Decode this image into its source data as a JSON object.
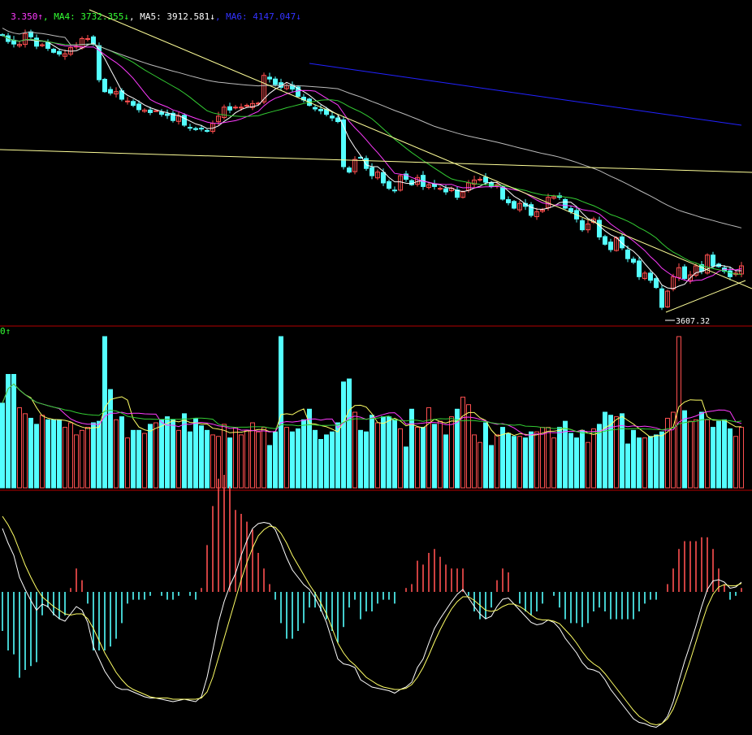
{
  "header": {
    "items": [
      {
        "text": "3.350↑",
        "color": "#ff3bff"
      },
      {
        "text": ", MA4: 3732.355↓",
        "color": "#33ff33"
      },
      {
        "text": ", MA5: 3912.581↓",
        "color": "#ffffff"
      },
      {
        "text": ", MA6: 4147.047↓",
        "color": "#3333ff"
      }
    ]
  },
  "volume_header": {
    "text": "0↑",
    "color": "#33ff33"
  },
  "colors": {
    "up": "#ff5050",
    "down": "#54ffff",
    "ma_white": "#ffffff",
    "ma_yellow": "#ffff66",
    "ma_magenta": "#ff3bff",
    "ma_green": "#33cc33",
    "ma_grey": "#bbbbbb",
    "ma_blue": "#2222ff",
    "panel_border": "#b40000",
    "trend_line": "#ffff99"
  },
  "chart_data": [
    {
      "type": "candlestick",
      "title": "",
      "price_range": [
        3570,
        4440
      ],
      "candles_count": 131,
      "low_marker": {
        "value": "3607.32",
        "index": 116
      },
      "close": [
        4369,
        4352,
        4345,
        4344,
        4374,
        4365,
        4339,
        4343,
        4333,
        4322,
        4317,
        4318,
        4335,
        4339,
        4360,
        4360,
        4344,
        4246,
        4213,
        4209,
        4213,
        4192,
        4187,
        4175,
        4163,
        4162,
        4155,
        4160,
        4150,
        4147,
        4133,
        4145,
        4120,
        4112,
        4108,
        4110,
        4103,
        4125,
        4145,
        4170,
        4162,
        4170,
        4170,
        4175,
        4180,
        4181,
        4258,
        4248,
        4233,
        4225,
        4230,
        4220,
        4200,
        4190,
        4175,
        4165,
        4160,
        4150,
        4140,
        4130,
        4005,
        3990,
        4025,
        4030,
        4000,
        3980,
        3990,
        3960,
        3945,
        3940,
        3980,
        3970,
        3955,
        3975,
        3950,
        3955,
        3950,
        3945,
        3935,
        3945,
        3920,
        3935,
        3960,
        3968,
        3970,
        3962,
        3950,
        3955,
        3915,
        3905,
        3890,
        3903,
        3895,
        3870,
        3880,
        3885,
        3920,
        3922,
        3920,
        3890,
        3880,
        3860,
        3830,
        3846,
        3860,
        3810,
        3790,
        3775,
        3808,
        3780,
        3750,
        3740,
        3700,
        3710,
        3690,
        3670,
        3615,
        3660,
        3700,
        3725,
        3695,
        3705,
        3730,
        3715,
        3760,
        3730,
        3728,
        3715,
        3700,
        3710,
        3730
      ],
      "volume_range": [
        0,
        100
      ],
      "volume": [
        56,
        75,
        75,
        53,
        49,
        46,
        42,
        48,
        45,
        45,
        45,
        40,
        43,
        35,
        38,
        40,
        43,
        44,
        100,
        65,
        45,
        47,
        33,
        38,
        38,
        36,
        42,
        43,
        45,
        47,
        45,
        38,
        49,
        37,
        46,
        41,
        38,
        35,
        34,
        42,
        33,
        40,
        35,
        38,
        43,
        37,
        40,
        28,
        37,
        100,
        40,
        37,
        39,
        45,
        52,
        38,
        32,
        35,
        37,
        43,
        70,
        72,
        50,
        38,
        37,
        48,
        43,
        47,
        47,
        45,
        39,
        27,
        52,
        40,
        40,
        53,
        42,
        44,
        35,
        47,
        52,
        60,
        55,
        35,
        30,
        43,
        28,
        35,
        40,
        36,
        34,
        34,
        33,
        37,
        37,
        40,
        40,
        33,
        40,
        44,
        36,
        33,
        38,
        30,
        39,
        42,
        50,
        48,
        47,
        49,
        29,
        38,
        33,
        33,
        34,
        35,
        37,
        46,
        50,
        100,
        51,
        44,
        45,
        50,
        45,
        40,
        44,
        45,
        39,
        34,
        40
      ]
    },
    {
      "type": "line",
      "title": "",
      "x_count": 131,
      "macd_dif": [
        0.52,
        0.4,
        0.3,
        0.12,
        0.02,
        -0.07,
        -0.15,
        -0.1,
        -0.12,
        -0.18,
        -0.22,
        -0.24,
        -0.18,
        -0.12,
        -0.15,
        -0.25,
        -0.45,
        -0.55,
        -0.65,
        -0.72,
        -0.78,
        -0.8,
        -0.8,
        -0.82,
        -0.84,
        -0.86,
        -0.87,
        -0.87,
        -0.88,
        -0.89,
        -0.9,
        -0.89,
        -0.88,
        -0.89,
        -0.9,
        -0.86,
        -0.7,
        -0.48,
        -0.25,
        -0.08,
        0.05,
        0.15,
        0.3,
        0.42,
        0.52,
        0.56,
        0.57,
        0.56,
        0.51,
        0.4,
        0.28,
        0.18,
        0.12,
        0.06,
        0.02,
        -0.05,
        -0.14,
        -0.25,
        -0.4,
        -0.55,
        -0.59,
        -0.6,
        -0.62,
        -0.72,
        -0.75,
        -0.78,
        -0.79,
        -0.8,
        -0.81,
        -0.83,
        -0.8,
        -0.78,
        -0.74,
        -0.62,
        -0.55,
        -0.42,
        -0.3,
        -0.22,
        -0.15,
        -0.08,
        -0.02,
        0.02,
        -0.05,
        -0.12,
        -0.18,
        -0.22,
        -0.2,
        -0.12,
        -0.06,
        -0.05,
        -0.1,
        -0.15,
        -0.2,
        -0.25,
        -0.27,
        -0.26,
        -0.23,
        -0.25,
        -0.3,
        -0.38,
        -0.44,
        -0.5,
        -0.58,
        -0.63,
        -0.64,
        -0.66,
        -0.72,
        -0.8,
        -0.86,
        -0.92,
        -0.98,
        -1.04,
        -1.07,
        -1.08,
        -1.1,
        -1.11,
        -1.08,
        -1.02,
        -0.9,
        -0.73,
        -0.57,
        -0.43,
        -0.28,
        -0.12,
        0.02,
        0.09,
        0.1,
        0.08,
        0.03,
        0.04,
        0.08
      ],
      "macd_dea": [
        0.62,
        0.55,
        0.46,
        0.34,
        0.22,
        0.12,
        0.03,
        -0.04,
        -0.08,
        -0.12,
        -0.15,
        -0.18,
        -0.19,
        -0.18,
        -0.18,
        -0.22,
        -0.3,
        -0.4,
        -0.5,
        -0.58,
        -0.66,
        -0.72,
        -0.77,
        -0.8,
        -0.82,
        -0.84,
        -0.86,
        -0.87,
        -0.87,
        -0.87,
        -0.88,
        -0.88,
        -0.88,
        -0.88,
        -0.88,
        -0.87,
        -0.82,
        -0.7,
        -0.54,
        -0.38,
        -0.22,
        -0.06,
        0.1,
        0.24,
        0.36,
        0.46,
        0.51,
        0.54,
        0.53,
        0.48,
        0.4,
        0.3,
        0.22,
        0.14,
        0.06,
        -0.01,
        -0.09,
        -0.18,
        -0.3,
        -0.42,
        -0.5,
        -0.56,
        -0.6,
        -0.65,
        -0.7,
        -0.73,
        -0.76,
        -0.78,
        -0.79,
        -0.8,
        -0.8,
        -0.79,
        -0.76,
        -0.7,
        -0.62,
        -0.52,
        -0.41,
        -0.31,
        -0.22,
        -0.14,
        -0.08,
        -0.04,
        -0.04,
        -0.07,
        -0.11,
        -0.15,
        -0.16,
        -0.15,
        -0.12,
        -0.1,
        -0.1,
        -0.12,
        -0.15,
        -0.19,
        -0.22,
        -0.23,
        -0.23,
        -0.24,
        -0.26,
        -0.31,
        -0.36,
        -0.42,
        -0.49,
        -0.55,
        -0.59,
        -0.62,
        -0.67,
        -0.73,
        -0.79,
        -0.85,
        -0.91,
        -0.97,
        -1.02,
        -1.05,
        -1.08,
        -1.09,
        -1.08,
        -1.04,
        -0.96,
        -0.84,
        -0.7,
        -0.56,
        -0.41,
        -0.26,
        -0.12,
        -0.02,
        0.04,
        0.06,
        0.05,
        0.05,
        0.07
      ]
    }
  ]
}
